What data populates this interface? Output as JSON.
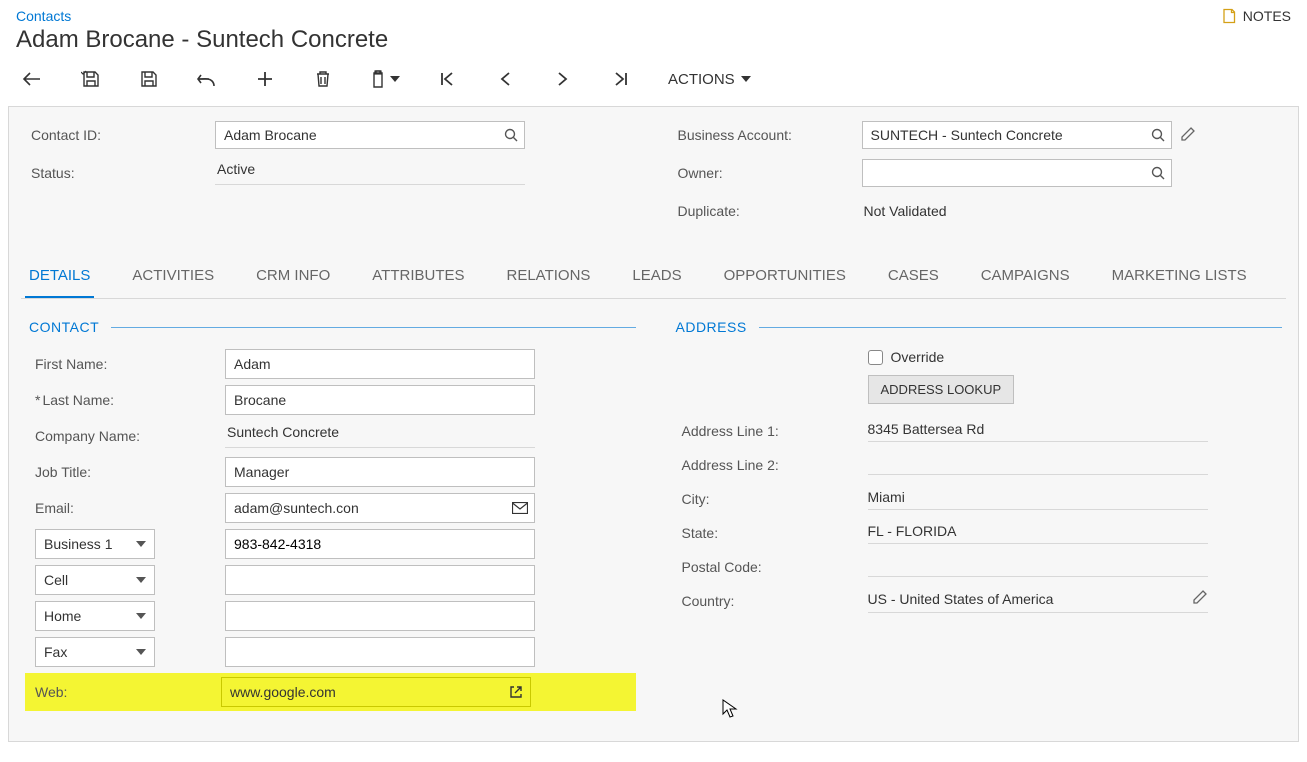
{
  "breadcrumb": {
    "link": "Contacts"
  },
  "page_title": "Adam Brocane - Suntech Concrete",
  "notes_label": "NOTES",
  "toolbar": {
    "actions_label": "ACTIONS"
  },
  "summary": {
    "contact_id_label": "Contact ID:",
    "contact_id_value": "Adam Brocane",
    "status_label": "Status:",
    "status_value": "Active",
    "business_account_label": "Business Account:",
    "business_account_value": "SUNTECH - Suntech Concrete",
    "owner_label": "Owner:",
    "owner_value": "",
    "duplicate_label": "Duplicate:",
    "duplicate_value": "Not Validated"
  },
  "tabs": [
    "DETAILS",
    "ACTIVITIES",
    "CRM INFO",
    "ATTRIBUTES",
    "RELATIONS",
    "LEADS",
    "OPPORTUNITIES",
    "CASES",
    "CAMPAIGNS",
    "MARKETING LISTS"
  ],
  "active_tab_index": 0,
  "contact_section": {
    "title": "CONTACT",
    "first_name_label": "First Name:",
    "first_name_value": "Adam",
    "last_name_label": "Last Name:",
    "last_name_value": "Brocane",
    "company_label": "Company Name:",
    "company_value": "Suntech Concrete",
    "job_title_label": "Job Title:",
    "job_title_value": "Manager",
    "email_label": "Email:",
    "email_value": "adam@suntech.con",
    "phone_types": [
      "Business 1",
      "Cell",
      "Home",
      "Fax"
    ],
    "phone_values": [
      "983-842-4318",
      "",
      "",
      ""
    ],
    "web_label": "Web:",
    "web_value": "www.google.com"
  },
  "address_section": {
    "title": "ADDRESS",
    "override_label": "Override",
    "lookup_label": "ADDRESS LOOKUP",
    "line1_label": "Address Line 1:",
    "line1_value": "8345 Battersea Rd",
    "line2_label": "Address Line 2:",
    "line2_value": "",
    "city_label": "City:",
    "city_value": "Miami",
    "state_label": "State:",
    "state_value": "FL - FLORIDA",
    "postal_label": "Postal Code:",
    "postal_value": "",
    "country_label": "Country:",
    "country_value": "US - United States of America"
  }
}
